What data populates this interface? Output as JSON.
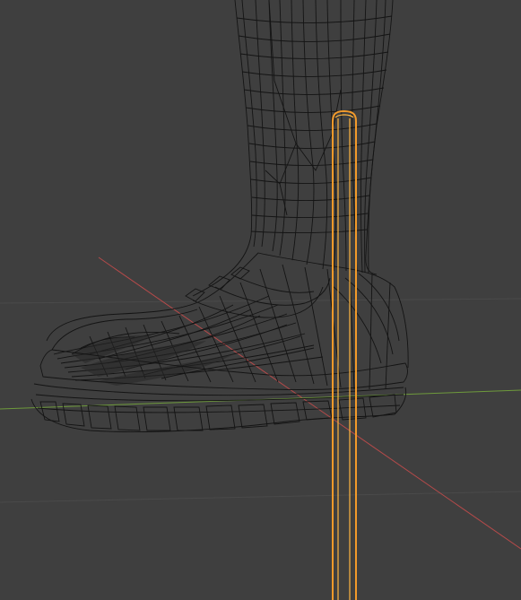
{
  "viewport": {
    "background_color": "#3f3f3f",
    "view_shading": "wireframe"
  },
  "colors": {
    "grid_line": "#4a4a4a",
    "x_axis": "#b64a4a",
    "y_axis": "#6e9a3c",
    "wire": "#141414",
    "selected_outline": "#f29a2a",
    "selected_inner": "#ffb640"
  },
  "objects": [
    {
      "name": "leg-boot-mesh",
      "selected": false,
      "display": "wireframe"
    },
    {
      "name": "vertical-rod",
      "selected": true,
      "display": "wireframe"
    }
  ]
}
